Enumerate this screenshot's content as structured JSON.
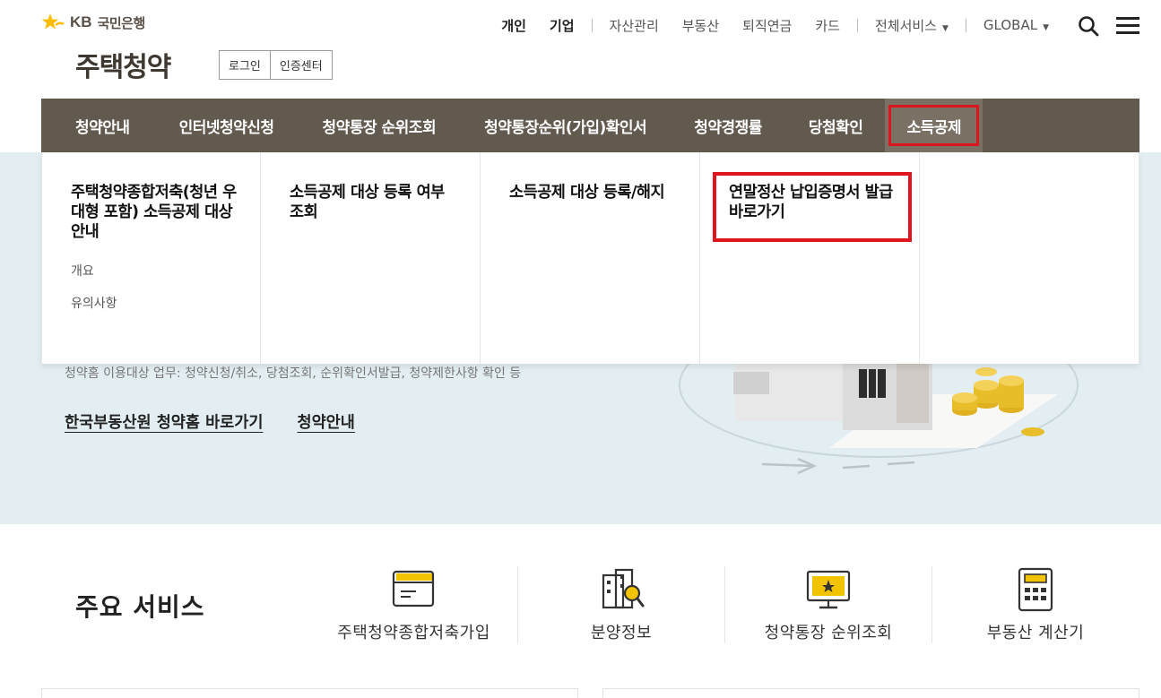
{
  "brand": {
    "name": "국민은행",
    "kb": "KB"
  },
  "site_title": "주택청약",
  "auth": {
    "login": "로그인",
    "certificate_center": "인증센터"
  },
  "top_nav": {
    "personal": "개인",
    "corporate": "기업",
    "asset": "자산관리",
    "real_estate": "부동산",
    "pension": "퇴직연금",
    "card": "카드",
    "all_services": "전체서비스",
    "global": "GLOBAL"
  },
  "gnb": [
    {
      "label": "청약안내"
    },
    {
      "label": "인터넷청약신청"
    },
    {
      "label": "청약통장 순위조회"
    },
    {
      "label": "청약통장순위(가입)확인서"
    },
    {
      "label": "청약경쟁률"
    },
    {
      "label": "당첨확인"
    },
    {
      "label": "소득공제",
      "active": true
    }
  ],
  "mega_menu": [
    {
      "title": "주택청약종합저축(청년 우대형 포함) 소득공제 대상 안내",
      "subs": [
        "개요",
        "유의사항"
      ]
    },
    {
      "title": "소득공제 대상 등록 여부 조회",
      "subs": []
    },
    {
      "title": "소득공제 대상 등록/해지",
      "subs": []
    },
    {
      "title": "연말정산 납입증명서 발급 바로가기",
      "subs": [],
      "highlighted": true
    },
    {
      "title": "",
      "subs": []
    }
  ],
  "hero": {
    "description": "청약홈 이용대상 업무: 청약신청/취소, 당첨조회, 순위확인서발급, 청약제한사항 확인 등",
    "link_applyhome": "한국부동산원 청약홈 바로가기",
    "link_guide": "청약안내"
  },
  "services": {
    "title": "주요 서비스",
    "items": [
      {
        "label": "주택청약종합저축가입",
        "icon": "card-icon"
      },
      {
        "label": "분양정보",
        "icon": "building-search-icon"
      },
      {
        "label": "청약통장 순위조회",
        "icon": "monitor-icon"
      },
      {
        "label": "부동산 계산기",
        "icon": "calculator-icon"
      }
    ]
  },
  "colors": {
    "gnb_bg": "#625a4f",
    "highlight": "#e0141e",
    "hero_bg": "#e3eef2",
    "brand_yellow": "#ffbc00"
  }
}
